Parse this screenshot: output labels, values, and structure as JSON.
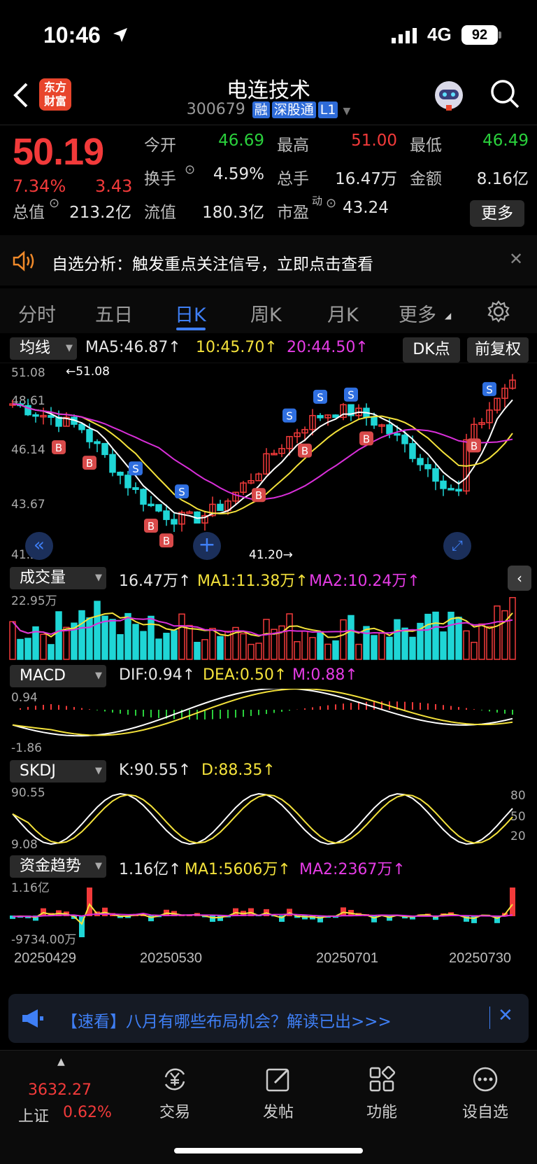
{
  "status": {
    "time": "10:46",
    "network": "4G",
    "battery": "92"
  },
  "header": {
    "title": "电连技术",
    "code": "300679",
    "tags": [
      "融",
      "深股通",
      "L1"
    ],
    "logo_text": "东方财富"
  },
  "quote": {
    "price": "50.19",
    "change_pct": "7.34%",
    "change_amt": "3.43",
    "fields": [
      {
        "label": "今开",
        "value": "46.69",
        "tone": "down"
      },
      {
        "label": "最高",
        "value": "51.00",
        "tone": "up"
      },
      {
        "label": "最低",
        "value": "46.49",
        "tone": "down"
      },
      {
        "label": "换手",
        "value": "4.59%",
        "tone": "white"
      },
      {
        "label": "总手",
        "value": "16.47万",
        "tone": "white"
      },
      {
        "label": "金额",
        "value": "8.16亿",
        "tone": "white"
      },
      {
        "label": "总值",
        "value": "213.2亿",
        "tone": "white"
      },
      {
        "label": "流值",
        "value": "180.3亿",
        "tone": "white"
      },
      {
        "label": "市盈",
        "value": "43.24",
        "tone": "white"
      }
    ],
    "pe_superscript": "动",
    "more_label": "更多"
  },
  "alert": {
    "text": "自选分析：触发重点关注信号，立即点击查看"
  },
  "tabs": [
    "分时",
    "五日",
    "日K",
    "周K",
    "月K",
    "更多"
  ],
  "active_tab": "日K",
  "main_chart": {
    "selector": "均线",
    "ma5": "MA5:46.87↑",
    "ma10": "10:45.70↑",
    "ma20": "20:44.50↑",
    "dk_label": "DK点",
    "adjust_label": "前复权",
    "y_ticks": [
      "51.08",
      "48.61",
      "46.14",
      "43.67",
      "41.20"
    ],
    "high_label": "←51.08",
    "low_label": "41.20→",
    "colors": {
      "up": "#f23a3a",
      "down": "#1fd6d6",
      "ma5": "#ffffff",
      "ma10": "#f4e23b",
      "ma20": "#d92fd9"
    }
  },
  "volume": {
    "selector": "成交量",
    "value": "16.47万↑",
    "ma1": "MA1:11.38万↑",
    "ma2": "MA2:10.24万↑",
    "y_top": "22.95万"
  },
  "macd": {
    "selector": "MACD",
    "dif": "DIF:0.94↑",
    "dea": "DEA:0.50↑",
    "m": "M:0.88↑",
    "y_top": "0.94",
    "y_bottom": "-1.86"
  },
  "skdj": {
    "selector": "SKDJ",
    "k": "K:90.55↑",
    "d": "D:88.35↑",
    "y_top": "90.55",
    "y_bottom": "9.08",
    "levels": [
      "80",
      "50",
      "20"
    ]
  },
  "fund": {
    "selector": "资金趋势",
    "value": "1.16亿↑",
    "ma1": "MA1:5606万↑",
    "ma2": "MA2:2367万↑",
    "y_top": "1.16亿",
    "y_bottom": "-9734.00万"
  },
  "dates": [
    "20250429",
    "20250530",
    "20250701",
    "20250730"
  ],
  "banner": {
    "text": "【速看】八月有哪些布局机会？解读已出>>>"
  },
  "bottom_nav": {
    "index_value": "3632.27",
    "index_name": "上证",
    "index_change": "0.62%",
    "items": [
      "交易",
      "发帖",
      "功能",
      "设自选"
    ]
  }
}
